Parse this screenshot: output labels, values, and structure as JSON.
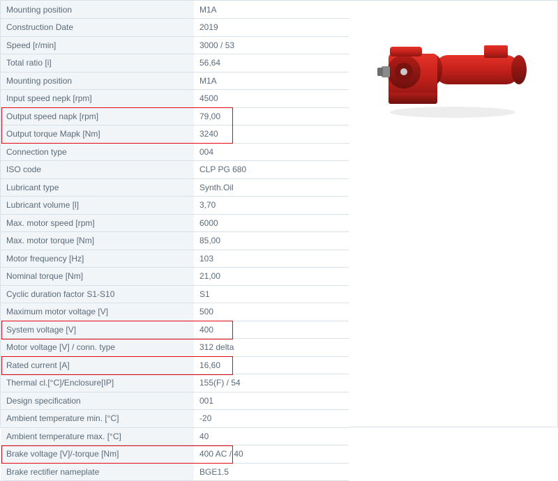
{
  "rows": [
    {
      "label": "Mounting position",
      "value": "M1A"
    },
    {
      "label": "Construction Date",
      "value": "2019"
    },
    {
      "label": "Speed [r/min]",
      "value": "3000 / 53"
    },
    {
      "label": "Total ratio [i]",
      "value": "56,64"
    },
    {
      "label": "Mounting position",
      "value": "M1A"
    },
    {
      "label": "Input speed nepk [rpm]",
      "value": "4500"
    },
    {
      "label": "Output speed napk [rpm]",
      "value": "79,00"
    },
    {
      "label": "Output torque Mapk [Nm]",
      "value": "3240"
    },
    {
      "label": "Connection type",
      "value": "004"
    },
    {
      "label": "ISO code",
      "value": "CLP PG 680"
    },
    {
      "label": "Lubricant type",
      "value": "Synth.Oil"
    },
    {
      "label": "Lubricant volume [l]",
      "value": "3,70"
    },
    {
      "label": "Max. motor speed [rpm]",
      "value": "6000"
    },
    {
      "label": "Max. motor torque [Nm]",
      "value": "85,00"
    },
    {
      "label": "Motor frequency [Hz]",
      "value": "103"
    },
    {
      "label": "Nominal torque [Nm]",
      "value": "21,00"
    },
    {
      "label": "Cyclic duration factor S1-S10",
      "value": "S1"
    },
    {
      "label": "Maximum motor voltage [V]",
      "value": "500"
    },
    {
      "label": "System voltage [V]",
      "value": "400"
    },
    {
      "label": "Motor voltage [V] / conn. type",
      "value": "312 delta"
    },
    {
      "label": "Rated current [A]",
      "value": "16,60"
    },
    {
      "label": "Thermal cl.[°C]/Enclosure[IP]",
      "value": "155(F) / 54"
    },
    {
      "label": "Design specification",
      "value": "001"
    },
    {
      "label": "Ambient temperature min. [°C]",
      "value": "-20"
    },
    {
      "label": "Ambient temperature max. [°C]",
      "value": "40"
    },
    {
      "label": "Brake voltage [V]/-torque [Nm]",
      "value": "400 AC / 40"
    },
    {
      "label": "Brake rectifier nameplate",
      "value": "BGE1.5"
    }
  ],
  "product_alt": "Red gearmotor product render"
}
